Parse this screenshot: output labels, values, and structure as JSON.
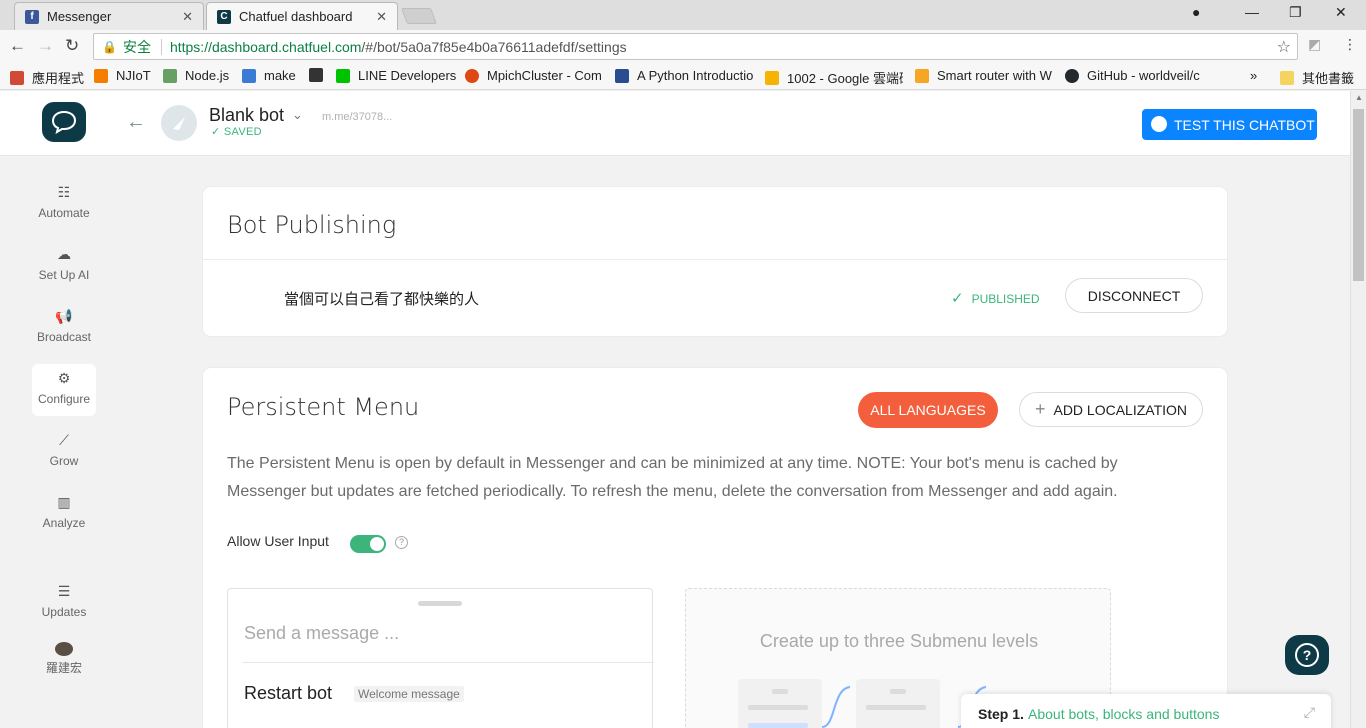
{
  "browser": {
    "tabs": [
      {
        "title": "Messenger",
        "favicon": "facebook-icon",
        "color": "#3b5998"
      },
      {
        "title": "Chatfuel dashboard",
        "favicon": "chatfuel-icon",
        "color": "#0d3a46"
      }
    ],
    "secure_label": "安全",
    "url_host": "https://dashboard.chatfuel.com",
    "url_path": "/#/bot/5a0a7f85e4b0a76611adefdf/settings",
    "bookmarks": [
      {
        "label": "應用程式",
        "icon": "apps-grid-icon",
        "color": "#d04a35"
      },
      {
        "label": "NJIoT",
        "icon": "blogger-icon",
        "color": "#f57d00"
      },
      {
        "label": "Node.js",
        "icon": "nodejs-icon",
        "color": "#68a063"
      },
      {
        "label": "make",
        "icon": "make-icon",
        "color": "#3a7bd5"
      },
      {
        "label": "",
        "icon": "panda-icon",
        "color": "#333333"
      },
      {
        "label": "LINE Developers",
        "icon": "line-icon",
        "color": "#00c300"
      },
      {
        "label": "MpichCluster - Com",
        "icon": "ubuntu-icon",
        "color": "#dd4814"
      },
      {
        "label": "A Python Introductio",
        "icon": "book-icon",
        "color": "#2a4d8f"
      },
      {
        "label": "1002 - Google 雲端硬",
        "icon": "google-drive-icon",
        "color": "#f4b400"
      },
      {
        "label": "Smart router with W",
        "icon": "instructables-icon",
        "color": "#f5a623"
      },
      {
        "label": "GitHub - worldveil/c",
        "icon": "github-icon",
        "color": "#24292e"
      }
    ],
    "overflow": "»",
    "other_bookmarks": "其他書籤"
  },
  "header": {
    "bot_name": "Blank bot",
    "saved_label": "SAVED",
    "bot_link": "m.me/37078...",
    "test_button": "TEST THIS CHATBOT"
  },
  "sidebar": {
    "items": [
      {
        "label": "Automate",
        "icon": "automate-icon",
        "glyph": "☷"
      },
      {
        "label": "Set Up AI",
        "icon": "ai-icon",
        "glyph": "☁"
      },
      {
        "label": "Broadcast",
        "icon": "megaphone-icon",
        "glyph": "📢"
      },
      {
        "label": "Configure",
        "icon": "gear-icon",
        "glyph": "⚙"
      },
      {
        "label": "Grow",
        "icon": "grow-icon",
        "glyph": "⟋"
      },
      {
        "label": "Analyze",
        "icon": "bar-chart-icon",
        "glyph": "▥"
      },
      {
        "label": "Updates",
        "icon": "updates-icon",
        "glyph": "☰"
      },
      {
        "label": "羅建宏",
        "icon": "user-avatar-icon",
        "glyph": ""
      }
    ],
    "active": "Configure"
  },
  "publishing": {
    "title": "Bot Publishing",
    "page_name": "當個可以自己看了都快樂的人",
    "status": "PUBLISHED",
    "disconnect": "DISCONNECT"
  },
  "persistent_menu": {
    "title": "Persistent Menu",
    "all_languages": "ALL LANGUAGES",
    "add_localization": "ADD LOCALIZATION",
    "description": "The Persistent Menu is open by default in Messenger and can be minimized at any time. NOTE: Your bot's menu is cached by Messenger but updates are fetched periodically. To refresh the menu, delete the conversation from Messenger and add again.",
    "allow_user_input": "Allow User Input",
    "allow_user_input_on": true,
    "send_placeholder": "Send a message ...",
    "restart_label": "Restart bot",
    "restart_badge": "Welcome message",
    "submenu_hint": "Create up to three Submenu levels"
  },
  "onboarding": {
    "step": "Step 1.",
    "link": "About bots, blocks and buttons"
  },
  "colors": {
    "brand_dark": "#0d3a46",
    "accent_blue": "#0a84ff",
    "accent_orange": "#f35f3c",
    "success_green": "#3bb57b"
  }
}
